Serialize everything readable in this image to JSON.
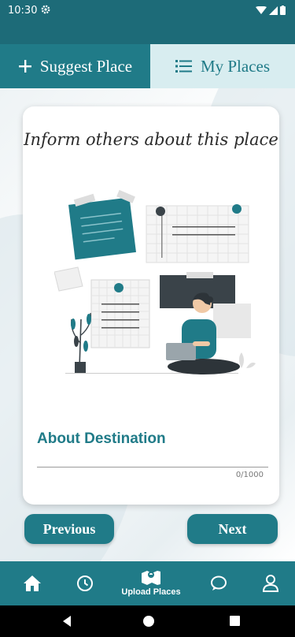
{
  "status": {
    "time": "10:30"
  },
  "tabs": [
    {
      "label": "Suggest Place",
      "icon": "plus-icon",
      "active": true
    },
    {
      "label": "My Places",
      "icon": "list-icon",
      "active": false
    }
  ],
  "card": {
    "title": "Inform others about this place",
    "field_label": "About Destination",
    "field_value": "",
    "counter": "0/1000"
  },
  "buttons": {
    "previous": "Previous",
    "next": "Next"
  },
  "bottom_nav": {
    "items": [
      {
        "icon": "home-icon"
      },
      {
        "icon": "history-icon"
      },
      {
        "icon": "map-icon",
        "label": "Upload Places"
      },
      {
        "icon": "chat-icon"
      },
      {
        "icon": "profile-icon"
      }
    ]
  },
  "colors": {
    "primary": "#207b88",
    "tab_inactive_bg": "#d8edf0",
    "status_bar": "#1d6b78"
  }
}
